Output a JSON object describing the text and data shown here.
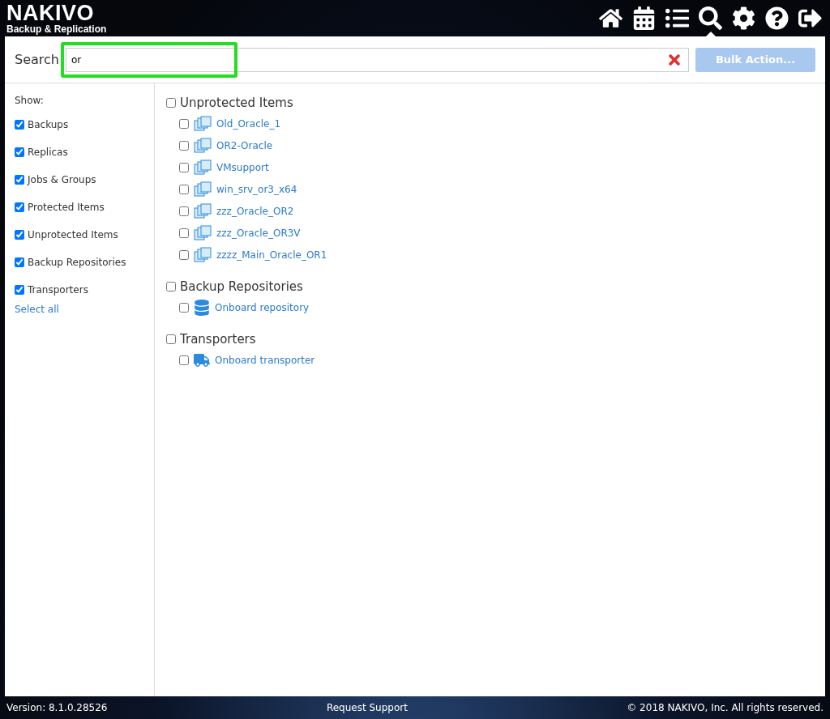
{
  "header": {
    "logo": {
      "title": "NAKIVO",
      "subtitle": "Backup & Replication"
    },
    "nav": [
      {
        "kind": "home",
        "selected": false
      },
      {
        "kind": "calendar",
        "selected": false
      },
      {
        "kind": "list",
        "selected": false
      },
      {
        "kind": "search",
        "selected": true
      },
      {
        "kind": "settings",
        "selected": false
      },
      {
        "kind": "help",
        "selected": false
      },
      {
        "kind": "logout",
        "selected": false
      }
    ]
  },
  "search": {
    "label": "Search",
    "value": "or",
    "highlighted": true,
    "bulk_action": {
      "label": "Bulk Action...",
      "disabled": true
    }
  },
  "sidebar": {
    "title": "Show:",
    "filters": [
      {
        "label": "Backups",
        "checked": true
      },
      {
        "label": "Replicas",
        "checked": true
      },
      {
        "label": "Jobs & Groups",
        "checked": true
      },
      {
        "label": "Protected Items",
        "checked": true
      },
      {
        "label": "Unprotected Items",
        "checked": true
      },
      {
        "label": "Backup Repositories",
        "checked": true
      },
      {
        "label": "Transporters",
        "checked": true
      }
    ],
    "select_all": "Select all"
  },
  "results": [
    {
      "title": "Unprotected Items",
      "checked": false,
      "items": [
        {
          "kind": "vm",
          "label": "Old_Oracle_1",
          "checked": false
        },
        {
          "kind": "vm",
          "label": "OR2-Oracle",
          "checked": false
        },
        {
          "kind": "vm",
          "label": "VMsupport",
          "checked": false
        },
        {
          "kind": "vm",
          "label": "win_srv_or3_x64",
          "checked": false
        },
        {
          "kind": "vm",
          "label": "zzz_Oracle_OR2",
          "checked": false
        },
        {
          "kind": "vm",
          "label": "zzz_Oracle_OR3V",
          "checked": false
        },
        {
          "kind": "vm",
          "label": "zzzz_Main_Oracle_OR1",
          "checked": false
        }
      ]
    },
    {
      "title": "Backup Repositories",
      "checked": false,
      "items": [
        {
          "kind": "repository",
          "label": "Onboard repository",
          "checked": false
        }
      ]
    },
    {
      "title": "Transporters",
      "checked": false,
      "items": [
        {
          "kind": "transporter",
          "label": "Onboard transporter",
          "checked": false
        }
      ]
    }
  ],
  "footer": {
    "version": "Version: 8.1.0.28526",
    "support": "Request Support",
    "copyright": "© 2018 NAKIVO, Inc. All rights reserved."
  }
}
